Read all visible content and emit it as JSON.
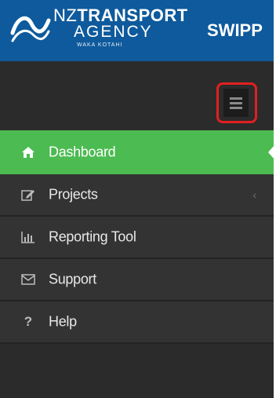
{
  "header": {
    "logo_line1_prefix": "NZ",
    "logo_line1_main": "TRANSPORT",
    "logo_line2": "AGENCY",
    "logo_line3": "WAKA KOTAHI",
    "app_name": "SWIPP"
  },
  "toolbar": {
    "menu_toggle_icon": "hamburger-menu-icon",
    "highlight_color": "#e02020"
  },
  "nav": {
    "items": [
      {
        "label": "Dashboard",
        "icon": "home-icon",
        "active": true
      },
      {
        "label": "Projects",
        "icon": "edit-icon",
        "has_submenu": true
      },
      {
        "label": "Reporting Tool",
        "icon": "bar-chart-icon"
      },
      {
        "label": "Support",
        "icon": "envelope-icon"
      },
      {
        "label": "Help",
        "icon": "question-icon"
      }
    ]
  },
  "colors": {
    "header_bg": "#0e5a9c",
    "sidebar_bg": "#2b2b2b",
    "active_item_bg": "#4cbb51"
  }
}
